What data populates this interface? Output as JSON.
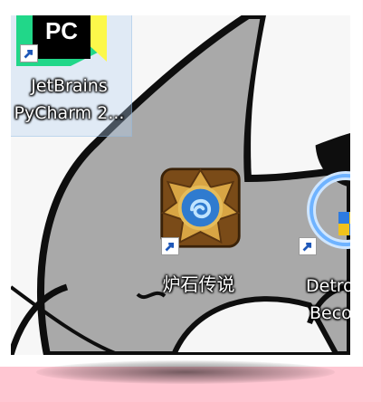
{
  "desktop": {
    "icons": [
      {
        "name": "pycharm",
        "label_line1": "JetBrains",
        "label_line2": "PyCharm 2..."
      },
      {
        "name": "hearthstone",
        "label_line1": "炉石传说"
      },
      {
        "name": "detroit",
        "label_line1": "Detro",
        "label_line2": "Beco"
      }
    ]
  },
  "colors": {
    "background": "#ffc6d2",
    "wallpaper_gray": "#a9a9a9",
    "hearth_gold": "#c98a2a",
    "hearth_blue": "#3a84d0"
  }
}
